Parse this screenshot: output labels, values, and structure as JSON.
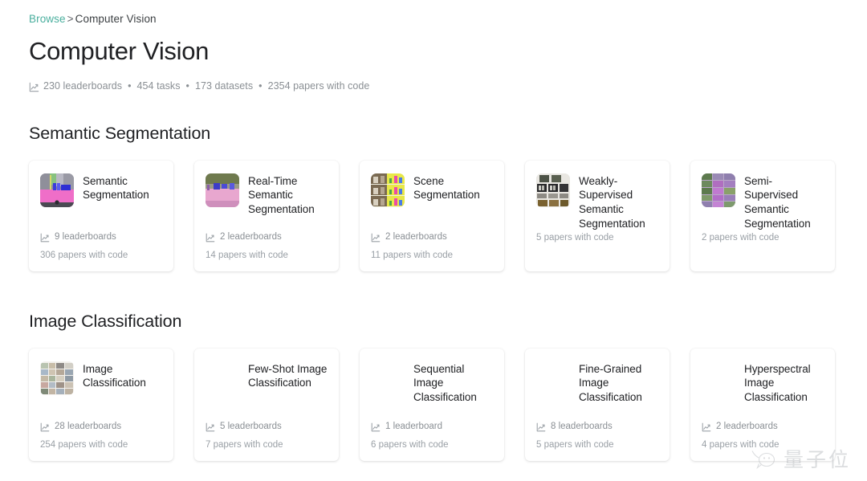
{
  "breadcrumb": {
    "root_label": "Browse",
    "separator": ">",
    "current_label": "Computer Vision"
  },
  "page_title": "Computer Vision",
  "stats": {
    "icon": "chart-line-icon",
    "leaderboards": "230 leaderboards",
    "tasks": "454 tasks",
    "datasets": "173 datasets",
    "papers": "2354 papers with code",
    "separator": "•"
  },
  "sections": [
    {
      "title": "Semantic Segmentation",
      "cards": [
        {
          "title": "Semantic Segmentation",
          "thumbnail": "street-scene-segmentation-thumbnail",
          "has_thumbnail": true,
          "leaderboards": "9 leaderboards",
          "papers": "306 papers with code"
        },
        {
          "title": "Real-Time Semantic Segmentation",
          "thumbnail": "road-scene-segmentation-thumbnail",
          "has_thumbnail": true,
          "leaderboards": "2 leaderboards",
          "papers": "14 papers with code"
        },
        {
          "title": "Scene Segmentation",
          "thumbnail": "scene-grid-barchart-thumbnail",
          "has_thumbnail": true,
          "leaderboards": "2 leaderboards",
          "papers": "11 papers with code"
        },
        {
          "title": "Weakly-Supervised Semantic Segmentation",
          "thumbnail": "dark-image-grid-thumbnail",
          "has_thumbnail": true,
          "leaderboards": null,
          "papers": "5 papers with code"
        },
        {
          "title": "Semi-Supervised Semantic Segmentation",
          "thumbnail": "purple-segmentation-grid-thumbnail",
          "has_thumbnail": true,
          "leaderboards": null,
          "papers": "2 papers with code"
        }
      ]
    },
    {
      "title": "Image Classification",
      "cards": [
        {
          "title": "Image Classification",
          "thumbnail": "photo-montage-grid-thumbnail",
          "has_thumbnail": true,
          "leaderboards": "28 leaderboards",
          "papers": "254 papers with code"
        },
        {
          "title": "Few-Shot Image Classification",
          "thumbnail": null,
          "has_thumbnail": false,
          "leaderboards": "5 leaderboards",
          "papers": "7 papers with code"
        },
        {
          "title": "Sequential Image Classification",
          "thumbnail": null,
          "has_thumbnail": false,
          "leaderboards": "1 leaderboard",
          "papers": "6 papers with code"
        },
        {
          "title": "Fine-Grained Image Classification",
          "thumbnail": null,
          "has_thumbnail": false,
          "leaderboards": "8 leaderboards",
          "papers": "5 papers with code"
        },
        {
          "title": "Hyperspectral Image Classification",
          "thumbnail": null,
          "has_thumbnail": false,
          "leaderboards": "2 leaderboards",
          "papers": "4 papers with code"
        }
      ]
    }
  ],
  "watermark": {
    "logo": "wechat-logo",
    "text": "量子位"
  },
  "colors": {
    "link": "#4aaf9e",
    "title": "#202124",
    "muted": "#8a8f94"
  }
}
